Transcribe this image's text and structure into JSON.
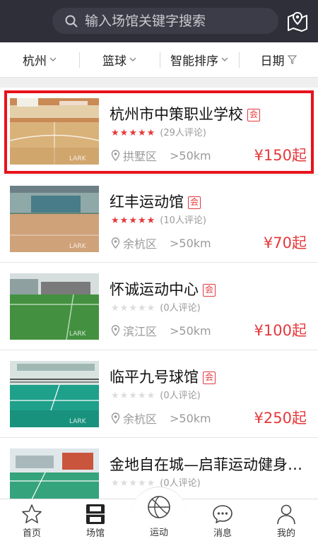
{
  "search": {
    "placeholder": "输入场馆关键字搜索"
  },
  "filters": {
    "city": "杭州",
    "sport": "篮球",
    "sort": "智能排序",
    "date": "日期"
  },
  "venues": [
    {
      "name": "杭州市中策职业学校",
      "badge": "会",
      "rating": 5,
      "reviews": "(29人评论)",
      "district": "拱墅区",
      "distance": ">50km",
      "price": "¥150起",
      "highlighted": true
    },
    {
      "name": "红丰运动馆",
      "badge": "会",
      "rating": 5,
      "reviews": "(10人评论)",
      "district": "余杭区",
      "distance": ">50km",
      "price": "¥70起"
    },
    {
      "name": "怀诚运动中心",
      "badge": "会",
      "rating": 0,
      "reviews": "(0人评论)",
      "district": "滨江区",
      "distance": ">50km",
      "price": "¥100起"
    },
    {
      "name": "临平九号球馆",
      "badge": "会",
      "rating": 0,
      "reviews": "(0人评论)",
      "district": "余杭区",
      "distance": ">50km",
      "price": "¥250起"
    },
    {
      "name": "金地自在城—启菲运动健身…",
      "rating": 0,
      "reviews": "(0人评论)"
    }
  ],
  "tabs": [
    {
      "label": "首页",
      "icon": "star-icon"
    },
    {
      "label": "场馆",
      "icon": "court-icon",
      "active": true
    },
    {
      "label": "运动",
      "icon": "ball-icon"
    },
    {
      "label": "消息",
      "icon": "chat-icon"
    },
    {
      "label": "我的",
      "icon": "person-icon"
    }
  ],
  "colors": {
    "header": "#2f2f3a",
    "accent": "#e4393c",
    "highlight": "#e8121a"
  }
}
